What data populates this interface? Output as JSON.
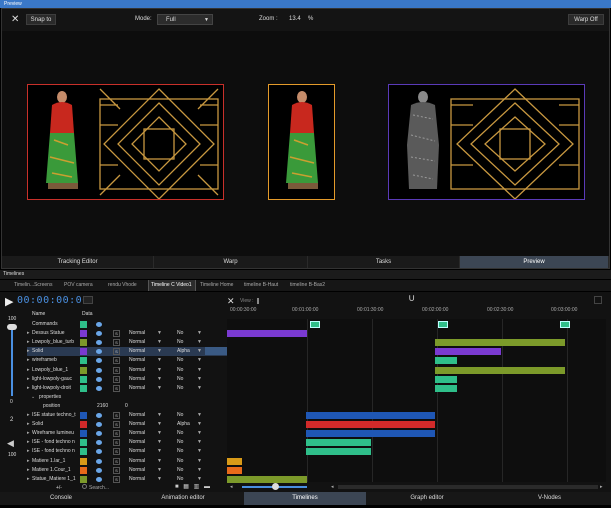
{
  "window": {
    "title": "Preview"
  },
  "toolbar": {
    "snap": "Snap to",
    "mode_label": "Mode:",
    "mode_value": "Full",
    "zoom_label": "Zoom :",
    "zoom_value": "13.4",
    "zoom_unit": "%",
    "warp_off": "Warp Off"
  },
  "view_tabs": [
    "Tracking Editor",
    "Warp",
    "Tasks",
    "Preview"
  ],
  "timelines": {
    "title": "Timelines",
    "tabs": [
      "Timelin...Screens",
      "POV camera",
      "rendu Vhode",
      "Timeline C Video1",
      "Timeline Home",
      "timeline B-Haut",
      "timeline B-Bas2"
    ],
    "timecode": "00:00:00:00",
    "view_label": "View :",
    "ticks": [
      "00:00:30:00",
      "00:01:00:00",
      "00:01:30:00",
      "00:02:00:00",
      "00:02:30:00",
      "00:03:00:00"
    ],
    "col_name": "Name",
    "col_data": "Data",
    "volume_top": "100",
    "volume_mid": "0",
    "volume_level": "2",
    "volume_bottom": "100",
    "rows": [
      {
        "name": "Commands",
        "color": "#2fbf8a",
        "blend": "",
        "alpha": "",
        "kind": "cmd"
      },
      {
        "name": "Dessus Statue",
        "color": "#7a3ad1",
        "blend": "Normal",
        "alpha": "No"
      },
      {
        "name": "Lowpoly_blue_turb",
        "color": "#7c9a2a",
        "blend": "Normal",
        "alpha": "No"
      },
      {
        "name": "Solid",
        "color": "#7a3ad1",
        "blend": "Normal",
        "alpha": "Alpha",
        "selected": true
      },
      {
        "name": "wireframeb",
        "color": "#2fbf8a",
        "blend": "Normal",
        "alpha": "No"
      },
      {
        "name": "Lowpoly_blue_1",
        "color": "#7c9a2a",
        "blend": "Normal",
        "alpha": "No"
      },
      {
        "name": "light-lowpoly-gauc",
        "color": "#2fbf8a",
        "blend": "Normal",
        "alpha": "No"
      },
      {
        "name": "light-lowpoly-droit",
        "color": "#2fbf8a",
        "blend": "Normal",
        "alpha": "No"
      },
      {
        "name": "properties",
        "kind": "sub"
      },
      {
        "name": "position",
        "data1": "2160",
        "data2": "0",
        "kind": "prop"
      },
      {
        "name": "ISE statue techno_t",
        "color": "#1f57b5",
        "blend": "Normal",
        "alpha": "No"
      },
      {
        "name": "Solid",
        "color": "#d12a2a",
        "blend": "Normal",
        "alpha": "Alpha"
      },
      {
        "name": "Wireframe lumineu",
        "color": "#1f57b5",
        "blend": "Normal",
        "alpha": "No"
      },
      {
        "name": "ISE - fond techno n",
        "color": "#2fbf8a",
        "blend": "Normal",
        "alpha": "No"
      },
      {
        "name": "ISE - fond techno n",
        "color": "#2fbf8a",
        "blend": "Normal",
        "alpha": "No"
      },
      {
        "name": "Matiere 1.lar_1",
        "color": "#d89a18",
        "blend": "Normal",
        "alpha": "No"
      },
      {
        "name": "Matiere 1.Cour_1",
        "color": "#e86a1a",
        "blend": "Normal",
        "alpha": "No"
      },
      {
        "name": "Statue_Matiere 1_1",
        "color": "#7c9a2a",
        "blend": "Normal",
        "alpha": "No"
      }
    ],
    "plusminus": "+/-",
    "search": "Search..."
  },
  "bottom_tabs": [
    "Console",
    "Animation editor",
    "Timelines",
    "Graph editor",
    "V-Nodes"
  ]
}
